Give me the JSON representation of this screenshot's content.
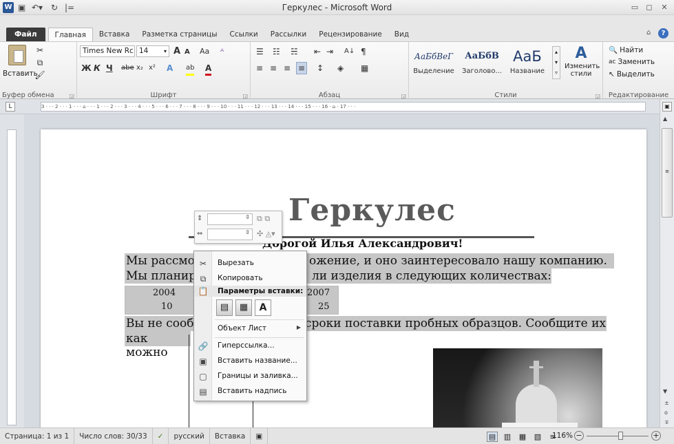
{
  "window": {
    "title": "Геркулес - Microsoft Word",
    "quick_access": {
      "word": "W",
      "save": "▣",
      "undo": "↶▾",
      "redo": "↻",
      "customize": "|="
    },
    "controls": {
      "minimize": "▭",
      "maximize": "◻",
      "close": "✕"
    }
  },
  "tabs": [
    "Файл",
    "Главная",
    "Вставка",
    "Разметка страницы",
    "Ссылки",
    "Рассылки",
    "Рецензирование",
    "Вид"
  ],
  "ribbon": {
    "clipboard": {
      "paste": "Вставить",
      "group": "Буфер обмена"
    },
    "font": {
      "name": "Times New Rc",
      "size": "14",
      "group": "Шрифт",
      "grow": "A",
      "shrink": "A",
      "case": "Aa",
      "clear": "ᴬ",
      "bold": "Ж",
      "italic": "К",
      "underline": "Ч",
      "strike": "abe",
      "sub": "x₂",
      "sup": "x²",
      "effects": "A",
      "highlight": "ab",
      "color": "A"
    },
    "paragraph": {
      "group": "Абзац",
      "pilcrow": "¶"
    },
    "styles": {
      "group": "Стили",
      "items": [
        {
          "sample": "АаБбВеГ",
          "name": "Выделение"
        },
        {
          "sample": "АаБбВ",
          "name": "Заголово..."
        },
        {
          "sample": "АаБ",
          "name": "Название"
        }
      ],
      "change": "Изменить стили"
    },
    "editing": {
      "group": "Редактирование",
      "find": "Найти",
      "replace": "Заменить",
      "select": "Выделить"
    }
  },
  "ruler": {
    "h_ticks": "3 · · · 2 · · · 1 · · · ⌂ · · · 1 · · · 2 · · · 3 · · · 4 · · · 5 · · · 6 · · · 7 · · · 8 · · · 9 · · · 10 · · · 11 · · · 12 · · · 13 · · · 14 · · · 15 · · · 16 · ⌂ · 17 · · ·",
    "v_ticks": [
      "1",
      "2",
      "3",
      "4",
      "5",
      "6",
      "7",
      "8"
    ]
  },
  "document": {
    "heading": "Геркулес",
    "salutation": "Дорогой Илья Александрович!",
    "line1_start": "Мы рассмо",
    "line1_end": "ожение, и оно заинтересовало нашу компанию.",
    "line2_start": "Мы планир",
    "line2_end": "ли изделия в следующих количествах:",
    "table_h_left": "2004",
    "table_h_right": "2007",
    "table_v_left": "10",
    "table_v_right": "25",
    "line3_start": "Вы не сооб",
    "line3_end": "сроки поставки пробных образцов. Сообщите их",
    "line4": "как можно"
  },
  "context_menu": {
    "cut": "Вырезать",
    "copy": "Копировать",
    "paste_options": "Параметры вставки:",
    "object": "Объект Лист",
    "hyperlink": "Гиперссылка...",
    "insert_caption": "Вставить название...",
    "borders": "Границы и заливка...",
    "insert_textbox": "Вставить надпись"
  },
  "status": {
    "page": "Страница: 1 из 1",
    "words": "Число слов: 30/33",
    "language": "русский",
    "mode": "Вставка",
    "zoom": "116%"
  }
}
